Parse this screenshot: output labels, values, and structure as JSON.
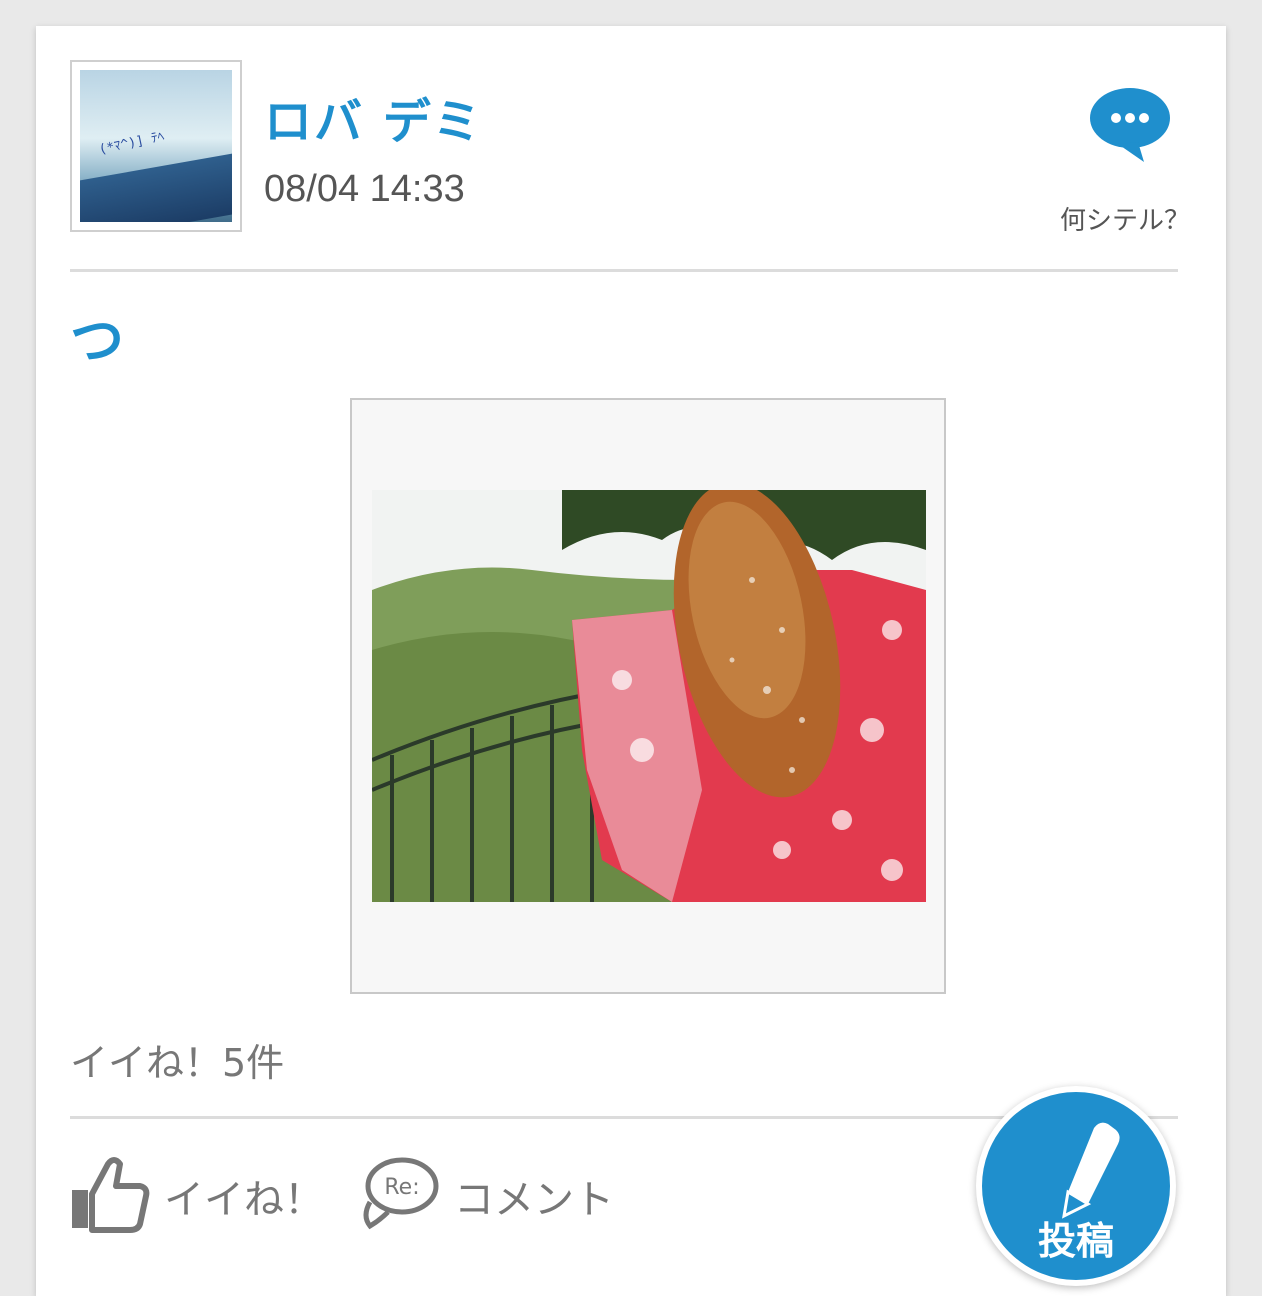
{
  "post": {
    "author": "ロバ デミ",
    "timestamp": "08/04 14:33",
    "status_link": "何シテル？",
    "title": "つ",
    "like_count_text": "イイね！5件"
  },
  "avatar": {
    "caption": "(*ﾏ^)] ﾃﾍ"
  },
  "actions": {
    "like_label": "イイね！",
    "comment_label": "コメント",
    "comment_badge": "Re:"
  },
  "fab": {
    "label": "投稿"
  },
  "colors": {
    "accent": "#1f8fcd",
    "muted_text": "#777777"
  }
}
